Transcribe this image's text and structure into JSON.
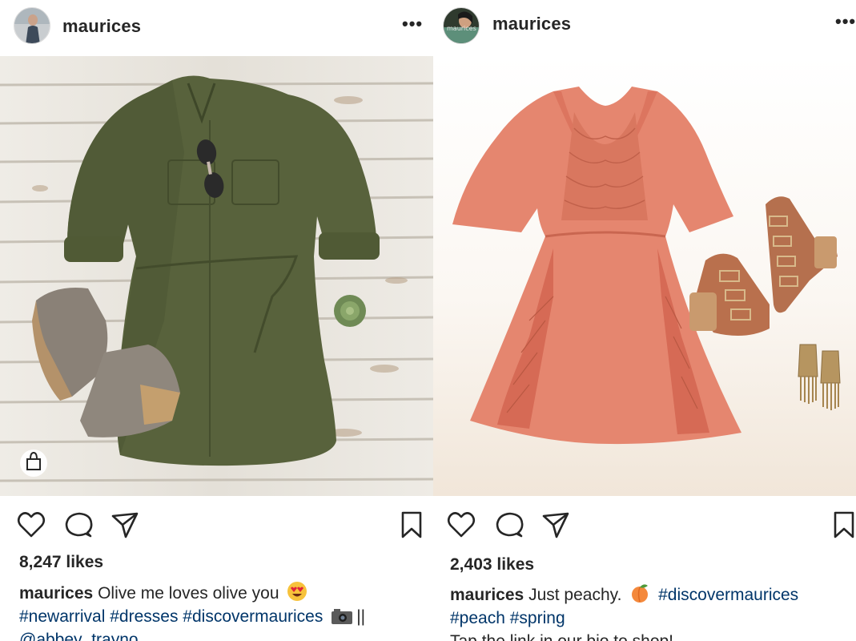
{
  "posts": [
    {
      "username": "maurices",
      "more_label": "•••",
      "likes": "8,247 likes",
      "caption": {
        "user": "maurices",
        "line1_text": "Olive me loves olive you",
        "line2_tags": [
          "#newarrival",
          "#dresses",
          "#discovermaurices"
        ],
        "line2_suffix": "||",
        "line3_mention": "@abbey_trayno"
      },
      "icons": [
        "heart-icon",
        "comment-icon",
        "share-icon",
        "bookmark-icon",
        "shopping-bag-icon",
        "camera-emoji",
        "heart-eyes-emoji"
      ],
      "colors": {
        "dress": "#56603a",
        "floor": "#e9e6e0"
      }
    },
    {
      "username": "maurices",
      "avatar_text": "maurices",
      "more_label": "•••",
      "likes": "2,403 likes",
      "caption": {
        "user": "maurices",
        "line1_text": "Just peachy.",
        "line1_tag": "#discovermaurices",
        "line2_tags": [
          "#peach",
          "#spring"
        ],
        "line3_text": "Tap the link in our bio to shop!"
      },
      "icons": [
        "heart-icon",
        "comment-icon",
        "share-icon",
        "bookmark-icon",
        "peach-emoji"
      ],
      "colors": {
        "dress": "#e5866f",
        "background": "#f8f2ea"
      }
    }
  ],
  "colors": {
    "link": "#003569",
    "text": "#262626"
  }
}
